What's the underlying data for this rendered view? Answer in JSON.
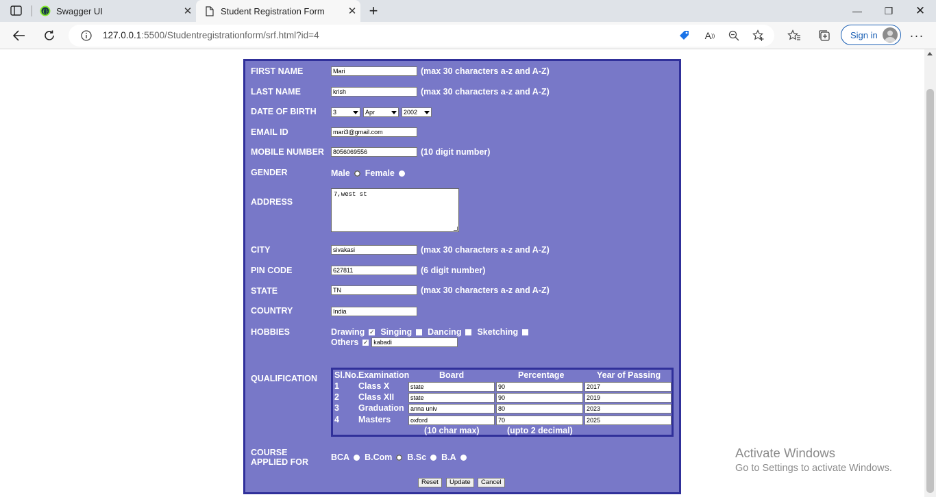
{
  "browser": {
    "tabs": [
      {
        "title": "Swagger UI"
      },
      {
        "title": "Student Registration Form"
      }
    ],
    "url_host": "127.0.0.1",
    "url_rest": ":5500/Studentregistrationform/srf.html?id=4",
    "signin_label": "Sign in"
  },
  "form": {
    "first_name": {
      "label": "FIRST NAME",
      "value": "Mari",
      "note": "(max 30 characters a-z and A-Z)"
    },
    "last_name": {
      "label": "LAST NAME",
      "value": "krish",
      "note": "(max 30 characters a-z and A-Z)"
    },
    "dob": {
      "label": "DATE OF BIRTH",
      "day": "3",
      "month": "Apr",
      "year": "2002"
    },
    "email": {
      "label": "EMAIL ID",
      "value": "mari3@gmail.com"
    },
    "mobile": {
      "label": "MOBILE NUMBER",
      "value": "8056069556",
      "note": "(10 digit number)"
    },
    "gender": {
      "label": "GENDER",
      "options": [
        "Male",
        "Female"
      ],
      "selected": "Male"
    },
    "address": {
      "label": "ADDRESS",
      "value": "7,west st"
    },
    "city": {
      "label": "CITY",
      "value": "sivakasi",
      "note": "(max 30 characters a-z and A-Z)"
    },
    "pin": {
      "label": "PIN CODE",
      "value": "627811",
      "note": "(6 digit number)"
    },
    "state": {
      "label": "STATE",
      "value": "TN",
      "note": "(max 30 characters a-z and A-Z)"
    },
    "country": {
      "label": "COUNTRY",
      "value": "India"
    },
    "hobbies": {
      "label": "HOBBIES",
      "items": [
        {
          "name": "Drawing",
          "checked": true
        },
        {
          "name": "Singing",
          "checked": false
        },
        {
          "name": "Dancing",
          "checked": false
        },
        {
          "name": "Sketching",
          "checked": false
        }
      ],
      "others_label": "Others",
      "others_checked": true,
      "others_value": "kabadi"
    },
    "qualification": {
      "label": "QUALIFICATION",
      "headers": [
        "Sl.No.",
        "Examination",
        "Board",
        "Percentage",
        "Year of Passing"
      ],
      "rows": [
        {
          "sn": "1",
          "exam": "Class X",
          "board": "state",
          "pct": "90",
          "year": "2017"
        },
        {
          "sn": "2",
          "exam": "Class XII",
          "board": "state",
          "pct": "90",
          "year": "2019"
        },
        {
          "sn": "3",
          "exam": "Graduation",
          "board": "anna univ",
          "pct": "80",
          "year": "2023"
        },
        {
          "sn": "4",
          "exam": "Masters",
          "board": "oxford",
          "pct": "70",
          "year": "2025"
        }
      ],
      "board_note": "(10 char max)",
      "pct_note": "(upto 2 decimal)"
    },
    "course": {
      "label_line1": "COURSE",
      "label_line2": "APPLIED FOR",
      "options": [
        "BCA",
        "B.Com",
        "B.Sc",
        "B.A"
      ],
      "selected": "B.Com"
    },
    "buttons": {
      "reset": "Reset",
      "update": "Update",
      "cancel": "Cancel"
    }
  },
  "watermark": {
    "line1": "Activate Windows",
    "line2": "Go to Settings to activate Windows."
  }
}
